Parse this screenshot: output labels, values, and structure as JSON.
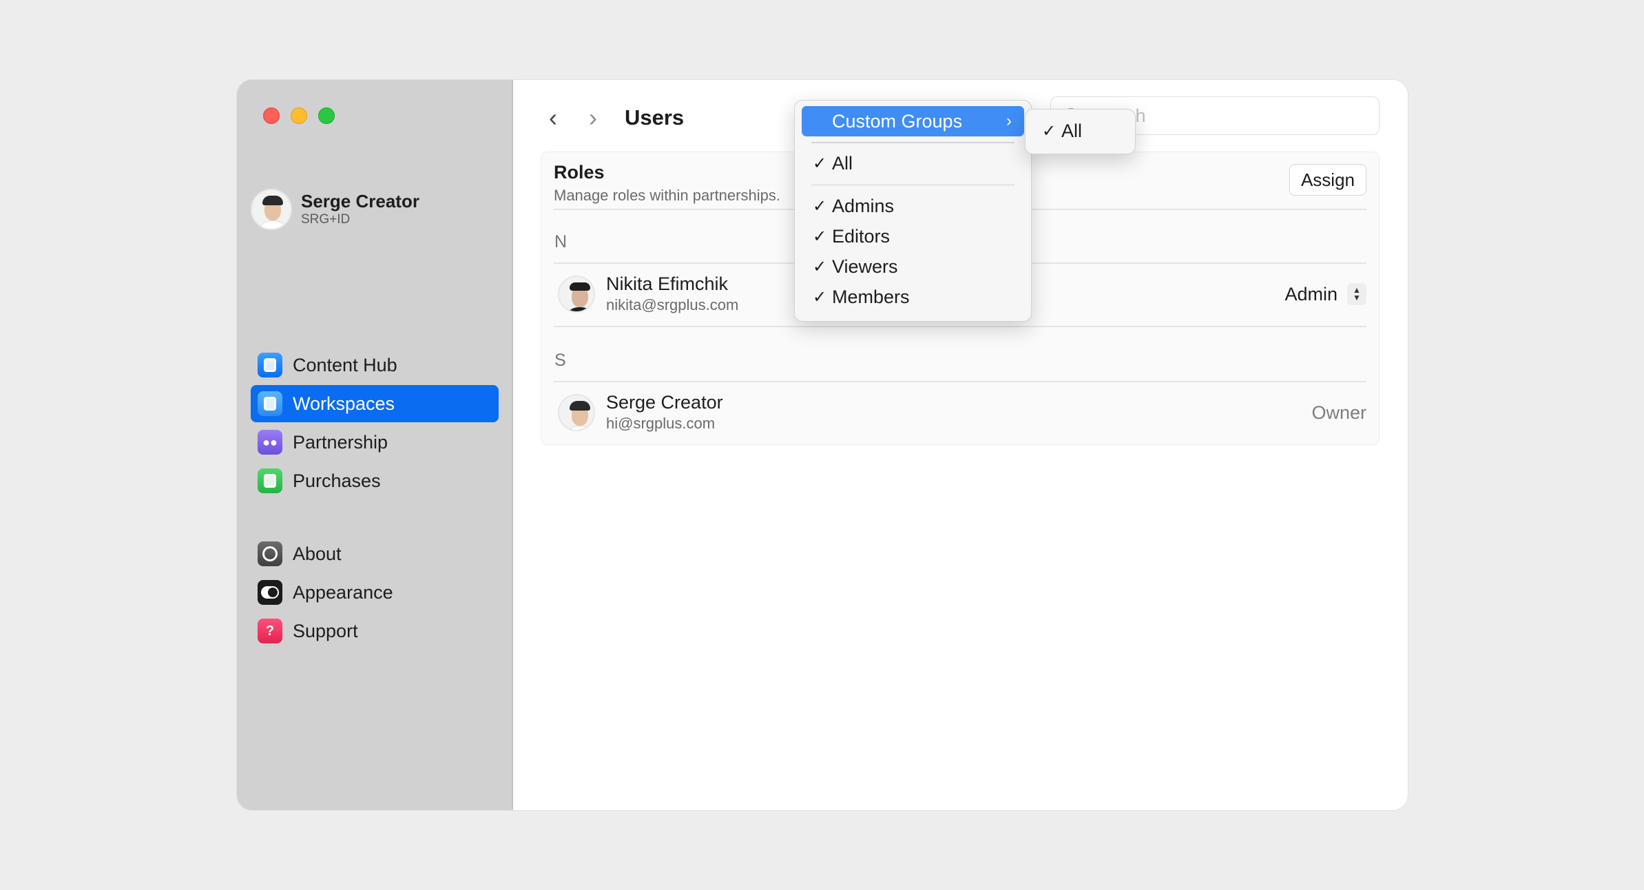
{
  "window": {
    "title": "Users"
  },
  "profile": {
    "name": "Serge Creator",
    "subtitle": "SRG+ID"
  },
  "sidebar": {
    "items": [
      {
        "label": "Content Hub",
        "icon": "content-hub-icon",
        "active": false
      },
      {
        "label": "Workspaces",
        "icon": "workspaces-icon",
        "active": true
      },
      {
        "label": "Partnership",
        "icon": "partnership-icon",
        "active": false
      },
      {
        "label": "Purchases",
        "icon": "purchases-icon",
        "active": false
      }
    ],
    "secondary": [
      {
        "label": "About",
        "icon": "about-gear-icon"
      },
      {
        "label": "Appearance",
        "icon": "appearance-toggle-icon"
      },
      {
        "label": "Support",
        "icon": "support-question-icon"
      }
    ]
  },
  "toolbar": {
    "back": "‹",
    "forward": "›",
    "title": "Users"
  },
  "search": {
    "placeholder": "Search",
    "value": ""
  },
  "roles": {
    "title": "Roles",
    "description": "Manage roles within partnerships.",
    "assign_label": "Assign"
  },
  "sections": [
    {
      "letter": "N",
      "users": [
        {
          "name": "Nikita Efimchik",
          "email": "nikita@srgplus.com",
          "role": "Admin",
          "editable": true
        }
      ]
    },
    {
      "letter": "S",
      "users": [
        {
          "name": "Serge Creator",
          "email": "hi@srgplus.com",
          "role": "Owner",
          "editable": false
        }
      ]
    }
  ],
  "filter_menu": {
    "highlighted": "Custom Groups",
    "chevron": "›",
    "check": "✓",
    "all": "All",
    "groups": [
      "Admins",
      "Editors",
      "Viewers",
      "Members"
    ]
  },
  "submenu": {
    "check": "✓",
    "items": [
      "All"
    ]
  },
  "stepper": {
    "up": "▲",
    "down": "▼"
  },
  "colors": {
    "accent": "#0a6cf0",
    "menu_highlight": "#3f8df5",
    "sidebar_bg": "#d1d1d1",
    "page_bg": "#ededed"
  }
}
